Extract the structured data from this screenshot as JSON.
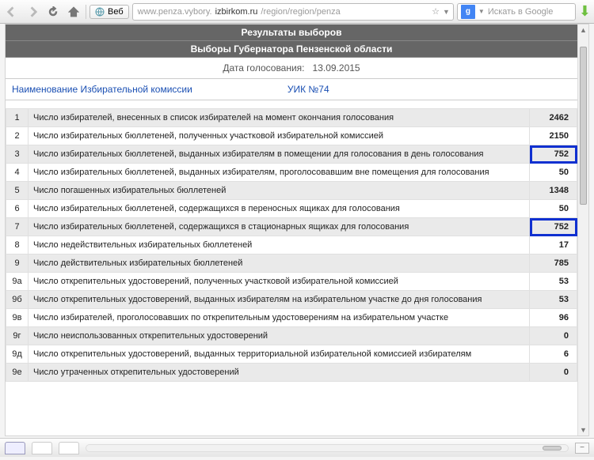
{
  "toolbar": {
    "web_label": "Веб",
    "url_pre": "www.penza.vybory.",
    "url_domain": "izbirkom.ru",
    "url_post": "/region/region/penza",
    "search_placeholder": "Искать в Google"
  },
  "page": {
    "header1": "Результаты выборов",
    "header2": "Выборы Губернатора Пензенской области",
    "date_label": "Дата голосования:",
    "date_value": "13.09.2015",
    "naimen_label": "Наименование Избирательной комиссии",
    "uik_label": "УИК №74"
  },
  "rows": [
    {
      "n": "1",
      "d": "Число избирателей, внесенных в список избирателей на момент окончания голосования",
      "v": "2462",
      "hl": false
    },
    {
      "n": "2",
      "d": "Число избирательных бюллетеней, полученных участковой избирательной комиссией",
      "v": "2150",
      "hl": false
    },
    {
      "n": "3",
      "d": "Число избирательных бюллетеней, выданных избирателям в помещении для голосования в день голосования",
      "v": "752",
      "hl": true
    },
    {
      "n": "4",
      "d": "Число избирательных бюллетеней, выданных избирателям, проголосовавшим вне помещения для голосования",
      "v": "50",
      "hl": false
    },
    {
      "n": "5",
      "d": "Число погашенных избирательных бюллетеней",
      "v": "1348",
      "hl": false
    },
    {
      "n": "6",
      "d": "Число избирательных бюллетеней, содержащихся в переносных ящиках для голосования",
      "v": "50",
      "hl": false
    },
    {
      "n": "7",
      "d": "Число избирательных бюллетеней, содержащихся в стационарных ящиках для голосования",
      "v": "752",
      "hl": true
    },
    {
      "n": "8",
      "d": "Число недействительных избирательных бюллетеней",
      "v": "17",
      "hl": false
    },
    {
      "n": "9",
      "d": "Число действительных избирательных бюллетеней",
      "v": "785",
      "hl": false
    },
    {
      "n": "9а",
      "d": "Число открепительных удостоверений, полученных участковой избирательной комиссией",
      "v": "53",
      "hl": false
    },
    {
      "n": "9б",
      "d": "Число открепительных удостоверений, выданных избирателям на избирательном участке до дня голосования",
      "v": "53",
      "hl": false
    },
    {
      "n": "9в",
      "d": "Число избирателей, проголосовавших по открепительным удостоверениям на избирательном участке",
      "v": "96",
      "hl": false
    },
    {
      "n": "9г",
      "d": "Число неиспользованных открепительных удостоверений",
      "v": "0",
      "hl": false
    },
    {
      "n": "9д",
      "d": "Число открепительных удостоверений, выданных территориальной избирательной комиссией избирателям",
      "v": "6",
      "hl": false
    },
    {
      "n": "9е",
      "d": "Число утраченных открепительных удостоверений",
      "v": "0",
      "hl": false
    }
  ]
}
